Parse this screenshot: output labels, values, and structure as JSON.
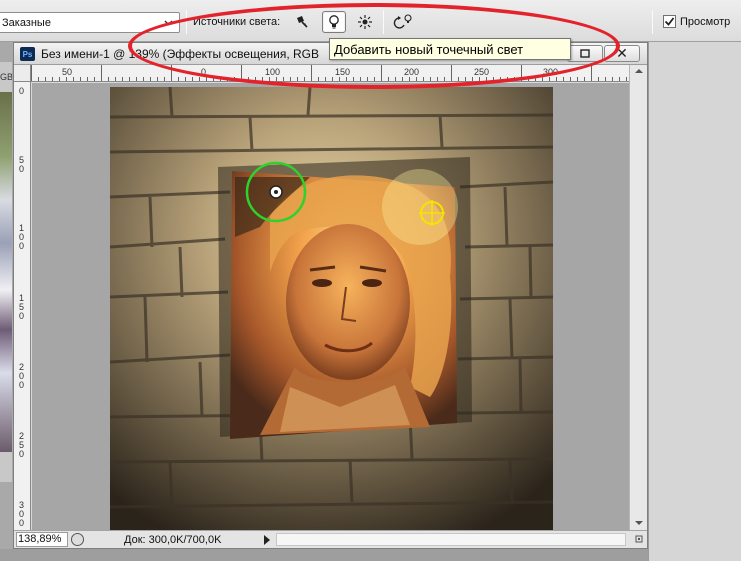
{
  "options_bar": {
    "preset_value": "Заказные",
    "light_sources_label": "Источники света:",
    "preview_label": "Просмотр",
    "preview_checked": true,
    "tools": [
      {
        "icon": "spot-light-icon",
        "active": false
      },
      {
        "icon": "point-light-icon",
        "active": true
      },
      {
        "icon": "infinite-light-icon",
        "active": false
      },
      {
        "icon": "reset-lights-icon",
        "active": false
      }
    ]
  },
  "tooltip": {
    "text": "Добавить новый точечный свет"
  },
  "document": {
    "ps_badge": "Ps",
    "title": "Без имени-1 @ 139% (Эффекты освещения, RGB",
    "minimize_glyph": "",
    "close_glyph": "✕",
    "ruler_top": [
      "0",
      "50",
      "0",
      "100",
      "150",
      "200",
      "250",
      "300"
    ],
    "ruler_left": [
      "0",
      "5 0",
      "1 0 0",
      "1 5 0",
      "2 0 0",
      "2 5 0",
      "3 0 0"
    ],
    "background_tab_text": "GB"
  },
  "status": {
    "zoom": "138,89%",
    "doc_size": "Док: 300,0K/700,0K"
  },
  "colors": {
    "highlight": "#e3232b",
    "tooltip_bg": "#ffffe1",
    "light_handle_green": "#2fd12a",
    "light_handle_yellow": "#f2e600"
  }
}
